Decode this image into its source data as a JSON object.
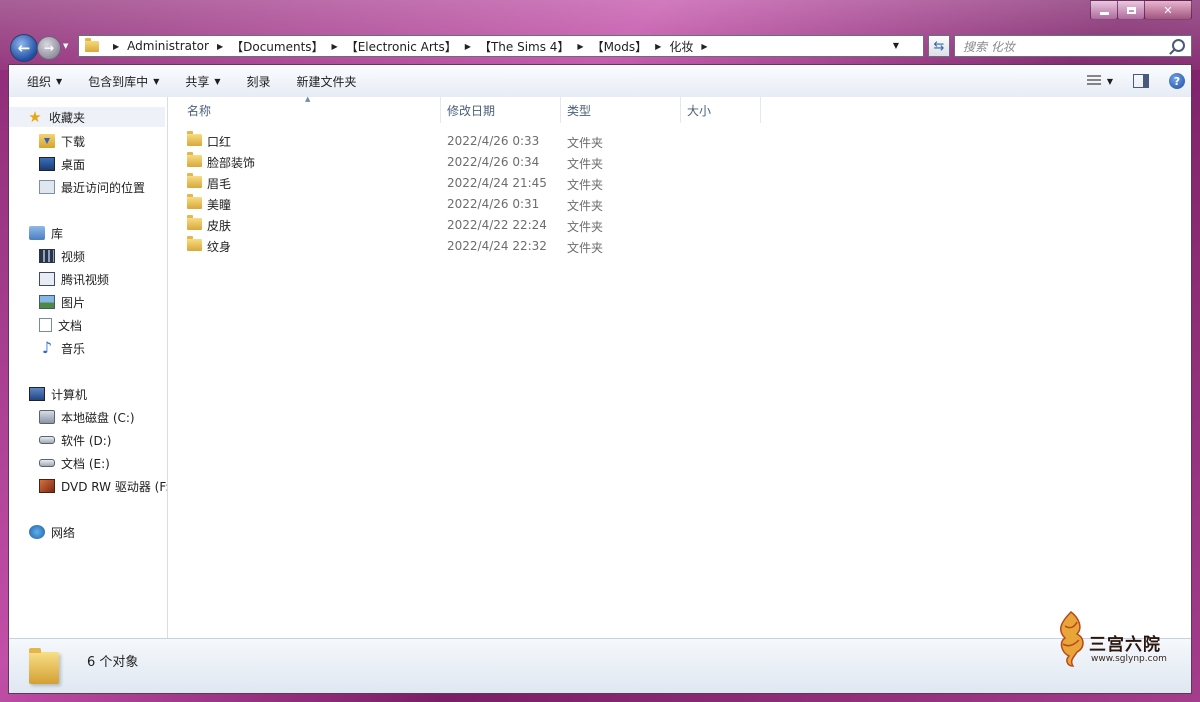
{
  "window": {
    "caption_buttons": [
      "minimize",
      "maximize",
      "close"
    ]
  },
  "address_bar": {
    "crumbs": [
      "Administrator",
      "【Documents】",
      "【Electronic Arts】",
      "【The Sims 4】",
      "【Mods】",
      "化妆"
    ]
  },
  "search": {
    "placeholder": "搜索 化妆"
  },
  "toolbar": {
    "organize": "组织",
    "include_in_library": "包含到库中",
    "share": "共享",
    "burn": "刻录",
    "new_folder": "新建文件夹"
  },
  "nav": {
    "favorites": {
      "label": "收藏夹",
      "items": [
        {
          "label": "下载",
          "icon": "download-folder-icon"
        },
        {
          "label": "桌面",
          "icon": "desktop-icon"
        },
        {
          "label": "最近访问的位置",
          "icon": "recent-places-icon"
        }
      ]
    },
    "libraries": {
      "label": "库",
      "items": [
        {
          "label": "视频",
          "icon": "video-library-icon"
        },
        {
          "label": "腾讯视频",
          "icon": "tencent-video-icon"
        },
        {
          "label": "图片",
          "icon": "pictures-icon"
        },
        {
          "label": "文档",
          "icon": "documents-icon"
        },
        {
          "label": "音乐",
          "icon": "music-icon"
        }
      ]
    },
    "computer": {
      "label": "计算机",
      "items": [
        {
          "label": "本地磁盘 (C:)",
          "icon": "system-drive-icon"
        },
        {
          "label": "软件 (D:)",
          "icon": "drive-icon"
        },
        {
          "label": "文档 (E:)",
          "icon": "drive-icon"
        },
        {
          "label": "DVD RW 驱动器 (F:",
          "icon": "dvd-drive-icon"
        }
      ]
    },
    "network": {
      "label": "网络"
    }
  },
  "columns": {
    "name": "名称",
    "date": "修改日期",
    "type": "类型",
    "size": "大小"
  },
  "files": [
    {
      "name": "口红",
      "date": "2022/4/26 0:33",
      "type": "文件夹"
    },
    {
      "name": "脸部装饰",
      "date": "2022/4/26 0:34",
      "type": "文件夹"
    },
    {
      "name": "眉毛",
      "date": "2022/4/24 21:45",
      "type": "文件夹"
    },
    {
      "name": "美瞳",
      "date": "2022/4/26 0:31",
      "type": "文件夹"
    },
    {
      "name": "皮肤",
      "date": "2022/4/22 22:24",
      "type": "文件夹"
    },
    {
      "name": "纹身",
      "date": "2022/4/24 22:32",
      "type": "文件夹"
    }
  ],
  "details": {
    "count": "6 个对象"
  },
  "watermark": {
    "text": "三宫六院",
    "url": "www.sglynp.com"
  },
  "colors": {
    "frame": "#a43d8c",
    "accent": "#1f4fa1",
    "folder": "#d8a83a"
  }
}
